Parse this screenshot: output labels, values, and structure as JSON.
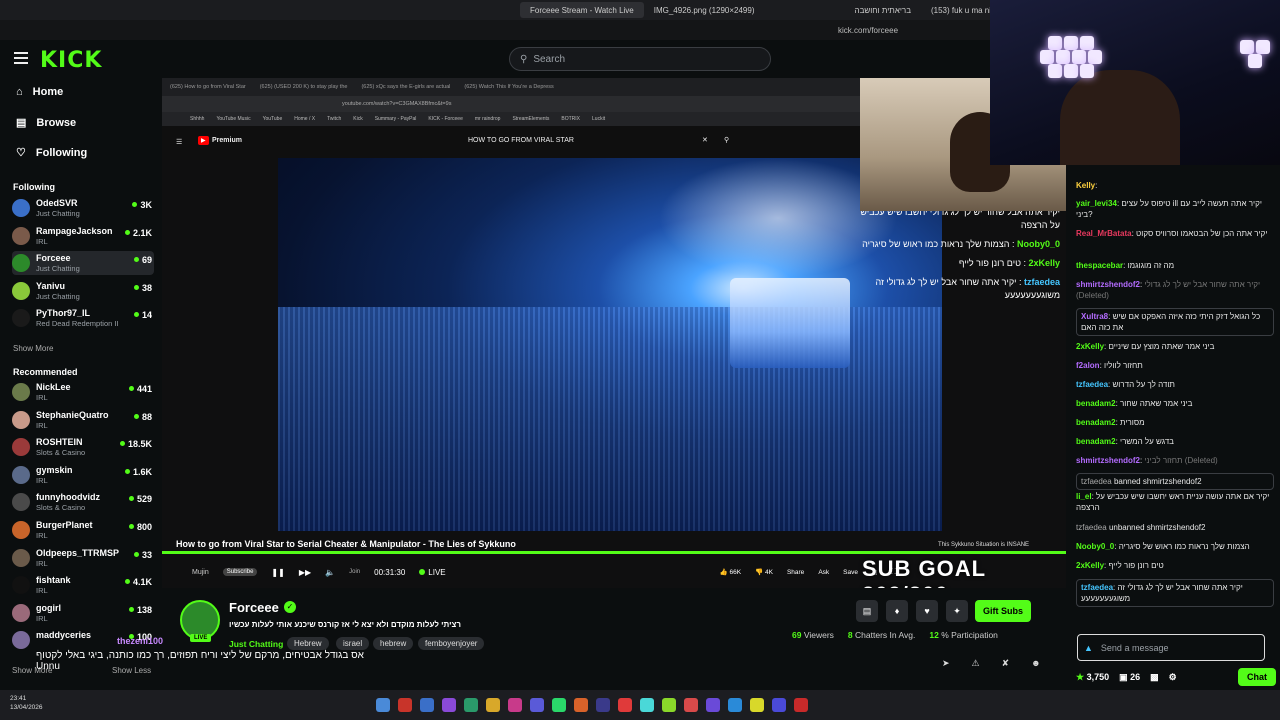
{
  "browser": {
    "tabs": [
      "Forceee Stream - Watch Live",
      "IMG_4926.png (1290×2499)",
      "בריאתית וחושבה",
      "(153) fuk u ma nigi - YouTube"
    ],
    "url": "kick.com/forceee"
  },
  "header": {
    "logo": "KICK",
    "search_placeholder": "Search"
  },
  "sidebar": {
    "nav": [
      {
        "label": "Home",
        "icon": "home-icon"
      },
      {
        "label": "Browse",
        "icon": "browse-icon"
      },
      {
        "label": "Following",
        "icon": "heart-icon"
      }
    ],
    "following_title": "Following",
    "following": [
      {
        "name": "OdedSVR",
        "category": "Just Chatting",
        "viewers": "3K",
        "color": "#3a6fc8"
      },
      {
        "name": "RampageJackson",
        "category": "IRL",
        "viewers": "2.1K",
        "color": "#7a5a4a"
      },
      {
        "name": "Forceee",
        "category": "Just Chatting",
        "viewers": "69",
        "color": "#2c8a2a"
      },
      {
        "name": "Yanivu",
        "category": "Just Chatting",
        "viewers": "38",
        "color": "#8ac83a"
      },
      {
        "name": "PyThor97_IL",
        "category": "Red Dead Redemption II",
        "viewers": "14",
        "color": "#1a1a1a"
      }
    ],
    "show_more": "Show More",
    "recommended_title": "Recommended",
    "recommended": [
      {
        "name": "NickLee",
        "category": "IRL",
        "viewers": "441",
        "color": "#6a7a4a"
      },
      {
        "name": "StephanieQuatro",
        "category": "IRL",
        "viewers": "88",
        "color": "#c89a8a"
      },
      {
        "name": "ROSHTEIN",
        "category": "Slots & Casino",
        "viewers": "18.5K",
        "color": "#9a3a3a"
      },
      {
        "name": "gymskin",
        "category": "IRL",
        "viewers": "1.6K",
        "color": "#5a6a8a"
      },
      {
        "name": "funnyhoodvidz",
        "category": "Slots & Casino",
        "viewers": "529",
        "color": "#4a4a4a"
      },
      {
        "name": "BurgerPlanet",
        "category": "IRL",
        "viewers": "800",
        "color": "#c8642a"
      },
      {
        "name": "Oldpeeps_TTRMSP",
        "category": "IRL",
        "viewers": "33",
        "color": "#6a5a4a"
      },
      {
        "name": "fishtank",
        "category": "IRL",
        "viewers": "4.1K",
        "color": "#111111"
      },
      {
        "name": "gogirl",
        "category": "IRL",
        "viewers": "138",
        "color": "#9a6a7a"
      },
      {
        "name": "maddyceries",
        "category": "",
        "viewers": "100",
        "color": "#7a6a9a"
      }
    ],
    "show_more2": "Show More",
    "show_less": "Show Less"
  },
  "youtube": {
    "tabs": [
      "(625) How to go from Viral Star",
      "(625) (USED 200 K) to stay play the",
      "(625) xQc says the E-girls are actual",
      "(625) Watch This If You're a Depress"
    ],
    "url": "youtube.com/watch?v=C3GMAX8Bfmc&t=9s",
    "bookmarks": [
      "Shhhh",
      "YouTube Music",
      "YouTube",
      "Home / X",
      "Twitch",
      "Kick",
      "Summary - PayPal",
      "KICK - Forceee",
      "mr raindrop",
      "StreamElements",
      "BOTRIX",
      "Luckit"
    ],
    "logo": "Premium",
    "search_query": "HOW TO GO FROM VIRAL STAR",
    "video_title": "How to go from Viral Star to Serial Cheater & Manipulator - The Lies of Sykkuno",
    "channel": "Mujin",
    "subscribe": "Subscribe",
    "join": "Join",
    "time": "00:31:30",
    "live": "LIVE",
    "likes": "66K",
    "dislikes": "4K",
    "share": "Share",
    "ask": "Ask",
    "save": "Save",
    "next_label": "This Sykkuno Situation is",
    "next_label2": "INSANE"
  },
  "score_overlay": "SUB GOAL 209/300",
  "overlay_chat": [
    {
      "user": "",
      "text": "יקיר אתה אבל שחור יש לך לג גדולי יחשבו שיש עכביש על הרצפה"
    },
    {
      "user": "Nooby0_0",
      "text": "הצמות שלך נראות כמו ראוש של סיגריה"
    },
    {
      "user": "2xKelly",
      "text": "טים רונן פור לייף"
    },
    {
      "user": "tzfaedea",
      "text": "יקיר אתה שחור אבל יש לך לג גדולי זה משוגעעעעעעע"
    }
  ],
  "chat": [
    {
      "user": "Kelly",
      "text": "",
      "color": "y"
    },
    {
      "user": "yair_levi34",
      "text": "טיפוס על עצים ill יקיר אתה תעשה לייב עם ביני?",
      "color": "u"
    },
    {
      "user": "Real_MrBatata",
      "text": "יקיר אתה הכן של הבטאמו וסרוויס סקוט",
      "color": "r"
    },
    {
      "user": "thespacebar",
      "text": "מה זה מוגוגמו",
      "color": "u"
    },
    {
      "user": "shmirtzshendof2",
      "text": "יקיר אתה שחור אבל יש לך לג גדולי (Deleted)",
      "color": "p"
    },
    {
      "user": "Xultra8",
      "text": "כל הגואל דזק היתי כזה איזה האפקט אם שיש את כזה האם",
      "color": "p"
    },
    {
      "user": "2xKelly",
      "text": "ביני אמר שאתה מוצץ עם שיניים",
      "color": "u"
    },
    {
      "user": "f2alon",
      "text": "תחזור לווליו",
      "color": "p"
    },
    {
      "user": "tzfaedea",
      "text": "תודה לך על הדרוש",
      "color": "b"
    },
    {
      "user": "benadam2",
      "text": "ביני אמר שאתה שחור",
      "color": "u"
    },
    {
      "user": "benadam2",
      "text": "מסורית",
      "color": "u"
    },
    {
      "user": "benadam2",
      "text": "בדגש על המשרי",
      "color": "u"
    },
    {
      "user": "shmirtzshendof2",
      "text": "תחזור לביני (Deleted)",
      "color": "p"
    },
    {
      "user": "tzfaedea",
      "text": "banned shmirtzshendof2",
      "color": "sys"
    },
    {
      "user": "li_el",
      "text": "יקיר אם אתה עושה עניית ראש יחשבו שיש עכביש על הרצפה",
      "color": "u"
    },
    {
      "user": "tzfaedea",
      "text": "unbanned shmirtzshendof2",
      "color": "sys"
    },
    {
      "user": "Nooby0_0",
      "text": "הצמות שלך נראות כמו ראוש של סיגריה",
      "color": "u"
    },
    {
      "user": "2xKelly",
      "text": "טים רונן פור לייף",
      "color": "u"
    },
    {
      "user": "tzfaedea",
      "text": "יקיר אתה שחור אבל יש לך לג גדולי זה משוגעעעעעעע",
      "color": "b"
    }
  ],
  "chat_input": {
    "placeholder": "Send a message"
  },
  "chat_footer": {
    "points": "3,750",
    "count": "26",
    "send": "Chat"
  },
  "streamer": {
    "name": "Forceee",
    "live": "LIVE",
    "title": "רציתי לעלות מוקדם ולא יצא לי אז קורנס שיכנע אותי לעלות עכשיו",
    "category": "Just Chatting",
    "tags": [
      "Hebrew",
      "israel",
      "hebrew",
      "femboyenjoyer"
    ],
    "viewers": "69",
    "viewers_label": "Viewers",
    "chatters": "8",
    "chatters_label": "Chatters In Avg.",
    "participation": "12",
    "participation_label": "% Participation",
    "gift": "Gift Subs"
  },
  "overlay_hebrew": "אס בגודל אבטיחים, מרקם של ליצי וריח תפוזים, רך כמו כותנה, ביגי באלי לקטוף",
  "overlay_hebrew2": "Unnu",
  "overlay_user": "thezeni100",
  "clock": {
    "time": "23:41",
    "date": "13/04/2026"
  }
}
